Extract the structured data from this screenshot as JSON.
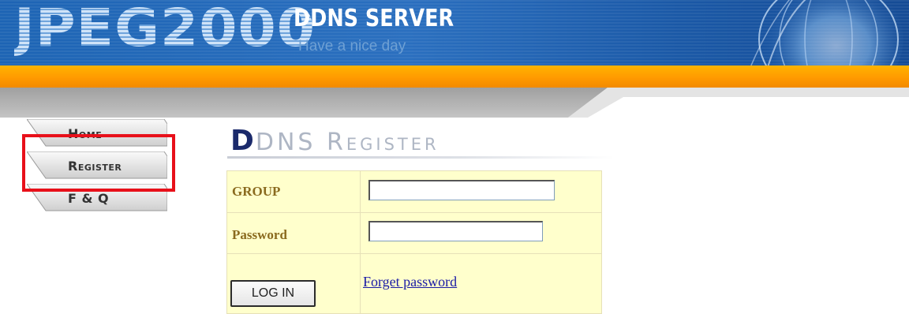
{
  "header": {
    "logo_text": "JPEG2000",
    "server_title": "DDNS SERVER",
    "tagline": "Have a nice day"
  },
  "nav": {
    "items": [
      {
        "label": "Home"
      },
      {
        "label": "Register"
      },
      {
        "label": "F & Q"
      }
    ],
    "highlighted": "Register"
  },
  "page": {
    "title_initial": "D",
    "title_rest": "DNS Register"
  },
  "form": {
    "group_label": "GROUP",
    "group_value": "",
    "password_label": "Password",
    "password_value": "",
    "login_button": "LOG IN",
    "forget_link": "Forget password"
  },
  "colors": {
    "banner_blue": "#1d64b4",
    "orange_bar": "#ff9a00",
    "highlight_red": "#e8101a",
    "form_bg": "#ffffcc",
    "label_brown": "#8a6a1e",
    "link_blue": "#1a1aa6"
  }
}
